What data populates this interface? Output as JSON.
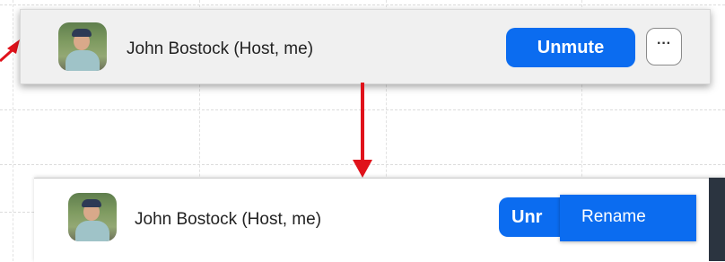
{
  "top_row": {
    "participant_name": "John Bostock (Host, me)",
    "unmute_label": "Unmute",
    "more_label": "···"
  },
  "bottom_row": {
    "participant_name": "John Bostock (Host, me)",
    "unmute_label_partial": "Unr",
    "menu_item_label": "Rename"
  },
  "colors": {
    "accent": "#0b6cf0",
    "arrow": "#e0121b"
  }
}
